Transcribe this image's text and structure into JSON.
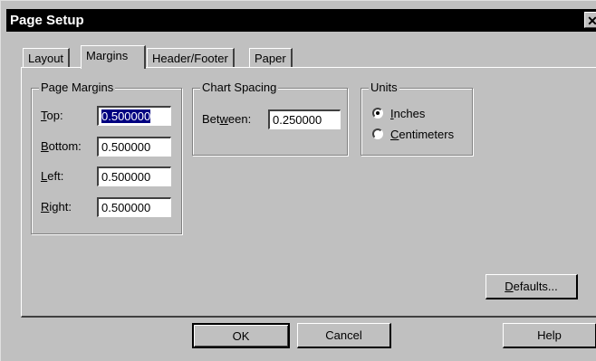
{
  "window": {
    "title": "Page Setup",
    "close_glyph": "✕"
  },
  "tabs": [
    {
      "label": "Layout"
    },
    {
      "label": "Margins",
      "active": true
    },
    {
      "label": "Header/Footer"
    },
    {
      "label": "Paper"
    }
  ],
  "page_margins": {
    "group_label": "Page Margins",
    "top": {
      "label_u": "T",
      "label_rest": "op:",
      "value": "0.500000",
      "selected": true
    },
    "bottom": {
      "label_u": "B",
      "label_rest": "ottom:",
      "value": "0.500000"
    },
    "left": {
      "label_u": "L",
      "label_rest": "eft:",
      "value": "0.500000"
    },
    "right": {
      "label_u": "R",
      "label_rest": "ight:",
      "value": "0.500000"
    }
  },
  "chart_spacing": {
    "group_label": "Chart Spacing",
    "between_pre": "Bet",
    "between_u": "w",
    "between_post": "een:",
    "value": "0.250000"
  },
  "units": {
    "group_label": "Units",
    "inches": {
      "u": "I",
      "rest": "nches",
      "checked": true
    },
    "centimeters": {
      "u": "C",
      "rest": "entimeters",
      "checked": false
    }
  },
  "buttons": {
    "defaults_u": "D",
    "defaults_rest": "efaults...",
    "ok": "OK",
    "cancel": "Cancel",
    "help": "Help"
  }
}
